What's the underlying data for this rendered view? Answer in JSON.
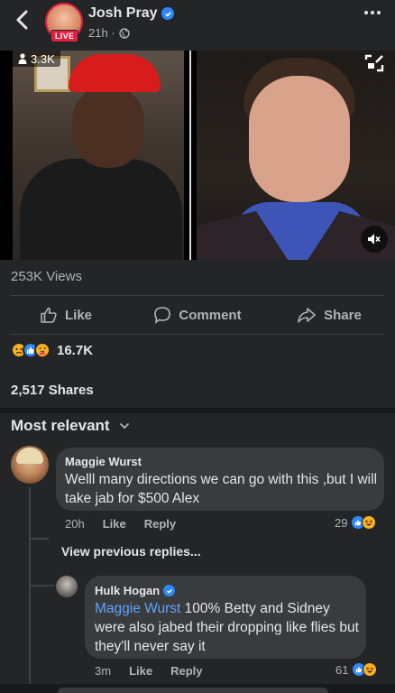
{
  "header": {
    "poster_name": "Josh Pray",
    "live_badge": "LIVE",
    "time": "21h ·",
    "back_icon": "chevron-left-icon",
    "more_icon": "more-icon"
  },
  "video": {
    "viewer_count": "3.3K"
  },
  "stats": {
    "views": "253K Views",
    "reaction_count": "16.7K",
    "shares": "2,517 Shares"
  },
  "actions": {
    "like": "Like",
    "comment": "Comment",
    "share": "Share"
  },
  "comments_header": {
    "sort_label": "Most relevant"
  },
  "comment1": {
    "author": "Maggie Wurst",
    "text": "Welll many directions we can go with this ,but I will take jab for $500 Alex",
    "time": "20h",
    "like": "Like",
    "reply": "Reply",
    "reactions": "29"
  },
  "view_previous": "View previous replies...",
  "reply1": {
    "author": "Hulk Hogan",
    "mention": "Maggie Wurst",
    "text": " 100% Betty and Sidney were also jabed their dropping like flies but they'll never say it",
    "time": "3m",
    "like": "Like",
    "reply": "Reply",
    "reactions": "61"
  },
  "colors": {
    "background": "#242526",
    "bubble": "#3a3b3c",
    "accent": "#2d88ff",
    "live": "#e41e3f"
  }
}
